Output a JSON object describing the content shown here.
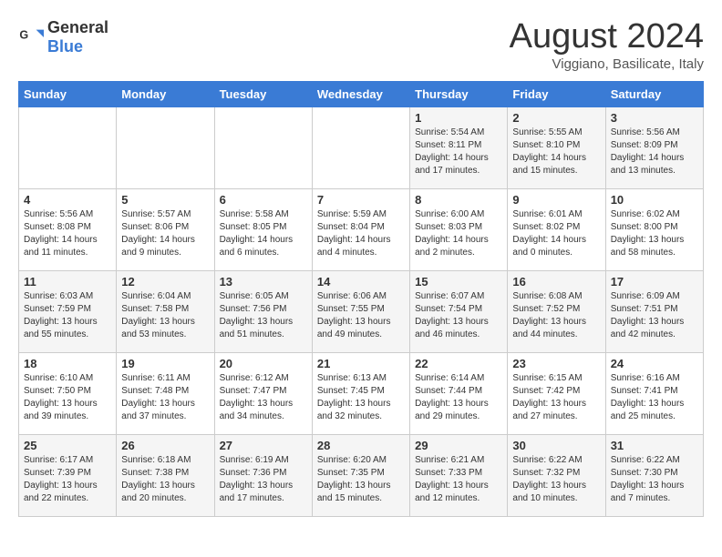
{
  "logo": {
    "general": "General",
    "blue": "Blue"
  },
  "title": "August 2024",
  "location": "Viggiano, Basilicate, Italy",
  "days_header": [
    "Sunday",
    "Monday",
    "Tuesday",
    "Wednesday",
    "Thursday",
    "Friday",
    "Saturday"
  ],
  "weeks": [
    [
      {
        "day": "",
        "info": ""
      },
      {
        "day": "",
        "info": ""
      },
      {
        "day": "",
        "info": ""
      },
      {
        "day": "",
        "info": ""
      },
      {
        "day": "1",
        "info": "Sunrise: 5:54 AM\nSunset: 8:11 PM\nDaylight: 14 hours\nand 17 minutes."
      },
      {
        "day": "2",
        "info": "Sunrise: 5:55 AM\nSunset: 8:10 PM\nDaylight: 14 hours\nand 15 minutes."
      },
      {
        "day": "3",
        "info": "Sunrise: 5:56 AM\nSunset: 8:09 PM\nDaylight: 14 hours\nand 13 minutes."
      }
    ],
    [
      {
        "day": "4",
        "info": "Sunrise: 5:56 AM\nSunset: 8:08 PM\nDaylight: 14 hours\nand 11 minutes."
      },
      {
        "day": "5",
        "info": "Sunrise: 5:57 AM\nSunset: 8:06 PM\nDaylight: 14 hours\nand 9 minutes."
      },
      {
        "day": "6",
        "info": "Sunrise: 5:58 AM\nSunset: 8:05 PM\nDaylight: 14 hours\nand 6 minutes."
      },
      {
        "day": "7",
        "info": "Sunrise: 5:59 AM\nSunset: 8:04 PM\nDaylight: 14 hours\nand 4 minutes."
      },
      {
        "day": "8",
        "info": "Sunrise: 6:00 AM\nSunset: 8:03 PM\nDaylight: 14 hours\nand 2 minutes."
      },
      {
        "day": "9",
        "info": "Sunrise: 6:01 AM\nSunset: 8:02 PM\nDaylight: 14 hours\nand 0 minutes."
      },
      {
        "day": "10",
        "info": "Sunrise: 6:02 AM\nSunset: 8:00 PM\nDaylight: 13 hours\nand 58 minutes."
      }
    ],
    [
      {
        "day": "11",
        "info": "Sunrise: 6:03 AM\nSunset: 7:59 PM\nDaylight: 13 hours\nand 55 minutes."
      },
      {
        "day": "12",
        "info": "Sunrise: 6:04 AM\nSunset: 7:58 PM\nDaylight: 13 hours\nand 53 minutes."
      },
      {
        "day": "13",
        "info": "Sunrise: 6:05 AM\nSunset: 7:56 PM\nDaylight: 13 hours\nand 51 minutes."
      },
      {
        "day": "14",
        "info": "Sunrise: 6:06 AM\nSunset: 7:55 PM\nDaylight: 13 hours\nand 49 minutes."
      },
      {
        "day": "15",
        "info": "Sunrise: 6:07 AM\nSunset: 7:54 PM\nDaylight: 13 hours\nand 46 minutes."
      },
      {
        "day": "16",
        "info": "Sunrise: 6:08 AM\nSunset: 7:52 PM\nDaylight: 13 hours\nand 44 minutes."
      },
      {
        "day": "17",
        "info": "Sunrise: 6:09 AM\nSunset: 7:51 PM\nDaylight: 13 hours\nand 42 minutes."
      }
    ],
    [
      {
        "day": "18",
        "info": "Sunrise: 6:10 AM\nSunset: 7:50 PM\nDaylight: 13 hours\nand 39 minutes."
      },
      {
        "day": "19",
        "info": "Sunrise: 6:11 AM\nSunset: 7:48 PM\nDaylight: 13 hours\nand 37 minutes."
      },
      {
        "day": "20",
        "info": "Sunrise: 6:12 AM\nSunset: 7:47 PM\nDaylight: 13 hours\nand 34 minutes."
      },
      {
        "day": "21",
        "info": "Sunrise: 6:13 AM\nSunset: 7:45 PM\nDaylight: 13 hours\nand 32 minutes."
      },
      {
        "day": "22",
        "info": "Sunrise: 6:14 AM\nSunset: 7:44 PM\nDaylight: 13 hours\nand 29 minutes."
      },
      {
        "day": "23",
        "info": "Sunrise: 6:15 AM\nSunset: 7:42 PM\nDaylight: 13 hours\nand 27 minutes."
      },
      {
        "day": "24",
        "info": "Sunrise: 6:16 AM\nSunset: 7:41 PM\nDaylight: 13 hours\nand 25 minutes."
      }
    ],
    [
      {
        "day": "25",
        "info": "Sunrise: 6:17 AM\nSunset: 7:39 PM\nDaylight: 13 hours\nand 22 minutes."
      },
      {
        "day": "26",
        "info": "Sunrise: 6:18 AM\nSunset: 7:38 PM\nDaylight: 13 hours\nand 20 minutes."
      },
      {
        "day": "27",
        "info": "Sunrise: 6:19 AM\nSunset: 7:36 PM\nDaylight: 13 hours\nand 17 minutes."
      },
      {
        "day": "28",
        "info": "Sunrise: 6:20 AM\nSunset: 7:35 PM\nDaylight: 13 hours\nand 15 minutes."
      },
      {
        "day": "29",
        "info": "Sunrise: 6:21 AM\nSunset: 7:33 PM\nDaylight: 13 hours\nand 12 minutes."
      },
      {
        "day": "30",
        "info": "Sunrise: 6:22 AM\nSunset: 7:32 PM\nDaylight: 13 hours\nand 10 minutes."
      },
      {
        "day": "31",
        "info": "Sunrise: 6:22 AM\nSunset: 7:30 PM\nDaylight: 13 hours\nand 7 minutes."
      }
    ]
  ]
}
